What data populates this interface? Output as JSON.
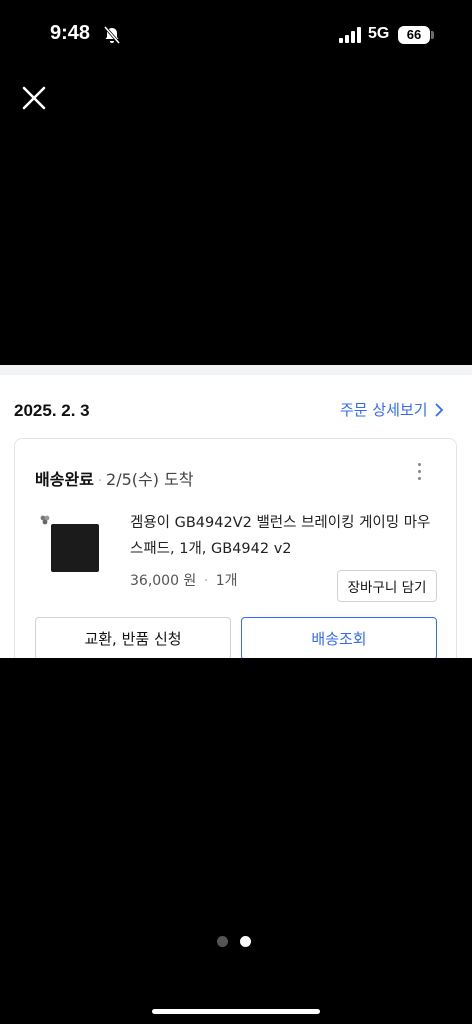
{
  "status_bar": {
    "time": "9:48",
    "network": "5G",
    "battery": "66"
  },
  "order": {
    "date": "2025. 2. 3",
    "detail_link_label": "주문 상세보기",
    "shipping_status": "배송완료",
    "separator": "·",
    "arrival": "2/5(수) 도착",
    "product": {
      "name": "겜용이 GB4942V2 밸런스 브레이킹 게이밍 마우스패드, 1개, GB4942 v2",
      "price": "36,000 원",
      "quantity": "1개"
    },
    "add_to_cart_label": "장바구니 담기",
    "exchange_return_label": "교환, 반품 신청",
    "track_shipping_label": "배송조회"
  },
  "colors": {
    "accent": "#346aff",
    "background": "#000000"
  }
}
